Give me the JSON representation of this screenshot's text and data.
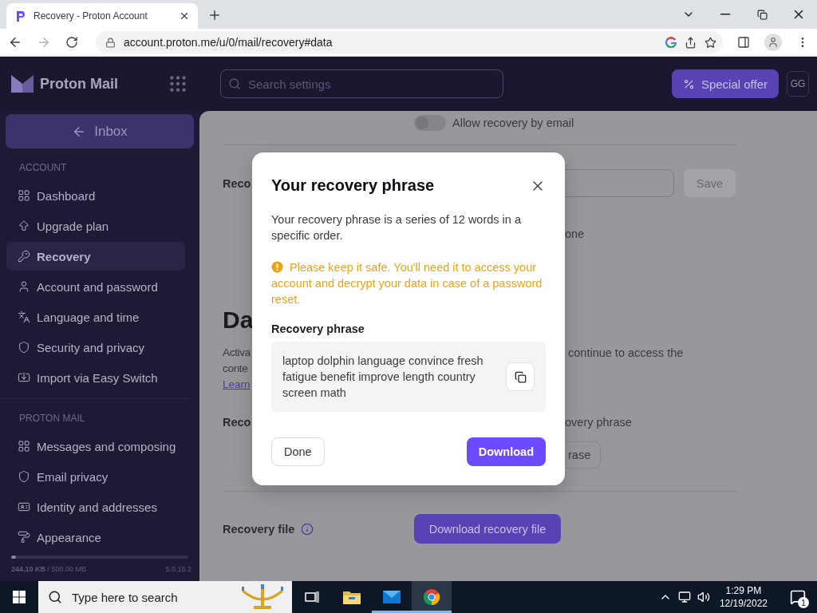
{
  "browser": {
    "tabs": [
      {
        "title": "Recovery - Proton Account",
        "selected": true
      }
    ],
    "url": "account.proton.me/u/0/mail/recovery#data"
  },
  "header": {
    "brand": "Proton Mail",
    "search": {
      "placeholder": "Search settings"
    },
    "offer_button": "Special offer",
    "avatar": "GG"
  },
  "sidebar": {
    "back_button": "Inbox",
    "sections": [
      {
        "title": "ACCOUNT",
        "items": [
          {
            "label": "Dashboard",
            "kind": "grid",
            "selected": false
          },
          {
            "label": "Upgrade plan",
            "kind": "upgrade",
            "selected": false
          },
          {
            "label": "Recovery",
            "kind": "key",
            "selected": true
          },
          {
            "label": "Account and password",
            "kind": "user",
            "selected": false
          },
          {
            "label": "Language and time",
            "kind": "language",
            "selected": false
          },
          {
            "label": "Security and privacy",
            "kind": "shield",
            "selected": false
          },
          {
            "label": "Import via Easy Switch",
            "kind": "import",
            "selected": false
          }
        ]
      },
      {
        "title": "PROTON MAIL",
        "items": [
          {
            "label": "Messages and composing",
            "kind": "grid",
            "selected": false
          },
          {
            "label": "Email privacy",
            "kind": "shield",
            "selected": false
          },
          {
            "label": "Identity and addresses",
            "kind": "id-card",
            "selected": false
          },
          {
            "label": "Appearance",
            "kind": "paint-roller",
            "selected": false
          }
        ]
      }
    ],
    "storage": {
      "text": "**244.10 KB** / 500.00 MB",
      "level": 0.02
    },
    "version": "5.0.15.2"
  },
  "background": {
    "email_toggle": {
      "label": "Allow recovery by email",
      "on": false
    },
    "phone_row": {
      "label": "Reco",
      "save_button": "Save",
      "note": "one"
    },
    "heading": "Da",
    "description_left": [
      "Activa",
      "conte"
    ],
    "link": "Learn",
    "description_right": "continue to access the",
    "phrase_row": {
      "label": "Reco",
      "text": "overy phrase",
      "button": "rase"
    },
    "file_row": {
      "label": "Recovery file",
      "button": "Download recovery file"
    }
  },
  "dialog": {
    "title": "Your recovery phrase",
    "intro": "Your recovery phrase is a series of 12 words in a specific order.",
    "warning": "Please keep it safe. You'll need it to access your account and decrypt your data in case of a password reset.",
    "phrase_label": "Recovery phrase",
    "phrase": "laptop dolphin language convince fresh fatigue benefit improve length country screen math",
    "done_button": "Done",
    "download_button": "Download"
  },
  "taskbar": {
    "search_placeholder": "Type here to search",
    "apps": [
      {
        "kind": "task-view",
        "running": false,
        "selected": false
      },
      {
        "kind": "folder",
        "running": false,
        "selected": false
      },
      {
        "kind": "mail",
        "running": true,
        "selected": false
      },
      {
        "kind": "chrome",
        "running": true,
        "selected": true
      }
    ],
    "time": "1:29 PM",
    "date": "12/19/2022",
    "notifications": "1"
  }
}
